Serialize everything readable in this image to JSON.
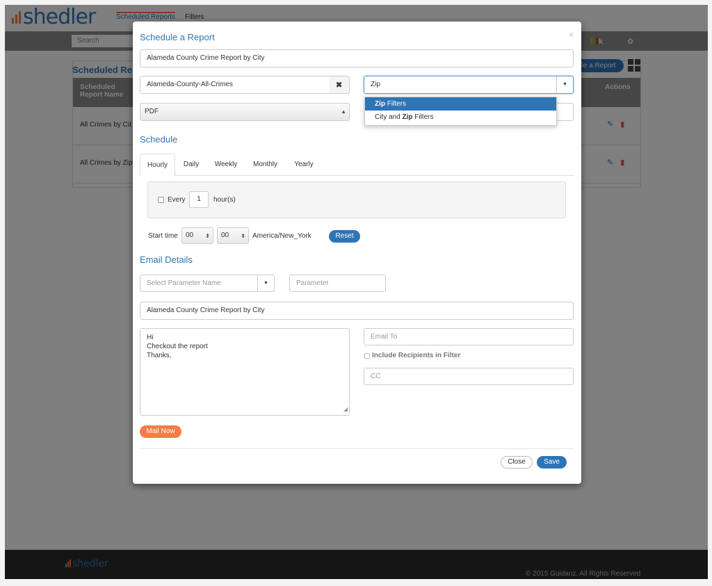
{
  "app": {
    "logo_text": "shedler",
    "nav": [
      "Scheduled Reports",
      "Filters"
    ],
    "search_placeholder": "Search",
    "kibana_label": "k",
    "panel_title": "Scheduled Re",
    "schedule_button": "le a Report",
    "table": {
      "headers": [
        "Scheduled Report Name",
        "Actions"
      ],
      "rows": [
        "All Crimes by Cit",
        "All Crimes by Zip"
      ]
    },
    "footer": {
      "logo_text": "shedler",
      "copyright": "© 2015 Guidanz. All Rights Reserved"
    }
  },
  "modal": {
    "title": "Schedule a Report",
    "close_glyph": "×",
    "report_name": "Alameda County Crime Report by City",
    "index_value": "Alameda-County-All-Crimes",
    "clear_glyph": "✖",
    "filter_value": "Zip",
    "filter_options": [
      {
        "bold": "Zip",
        "rest": " Filters"
      },
      {
        "pre": "City and ",
        "bold": "Zip",
        "rest": " Filters"
      }
    ],
    "format_value": "PDF",
    "schedule_title": "Schedule",
    "tabs": [
      "Hourly",
      "Daily",
      "Weekly",
      "Monthly",
      "Yearly"
    ],
    "active_tab": "Hourly",
    "hourly": {
      "every_label": "Every",
      "hours_value": "1",
      "unit_label": "hour(s)"
    },
    "start_time": {
      "label": "Start time",
      "hour": "00",
      "minute": "00",
      "timezone": "America/New_York",
      "reset_label": "Reset"
    },
    "email_title": "Email Details",
    "param_name_placeholder": "Select Parameter Name",
    "param_placeholder": "Parameter",
    "subject": "Alameda County Crime Report by City",
    "body": "Hi\nCheckout the report\nThanks,",
    "email_to_placeholder": "Email To",
    "include_recipients_label": "Include Recipients in Filter",
    "cc_placeholder": "CC",
    "mail_now_label": "Mail Now",
    "close_label": "Close",
    "save_label": "Save"
  },
  "colors": {
    "brand_blue": "#2e75b6",
    "accent_orange": "#f47d43"
  }
}
